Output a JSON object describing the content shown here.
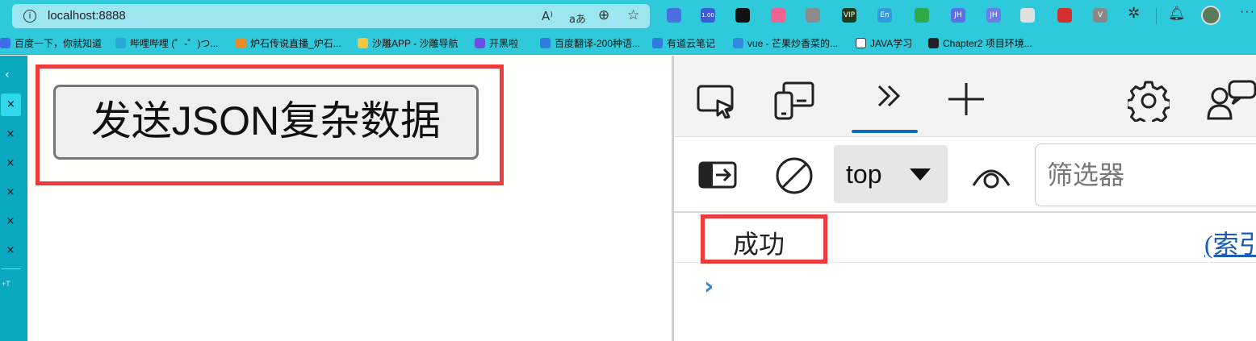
{
  "browser": {
    "url": "localhost:8888",
    "read_aloud_icon": "A⁾",
    "translate_icon": "aあ",
    "zoom_icon": "⊕",
    "favorite_icon": "☆"
  },
  "extensions": [
    {
      "name": "bird-extension-icon",
      "color": "#4a6ee0",
      "label": ""
    },
    {
      "name": "video-extension-icon",
      "color": "#3b5bdb",
      "label": "1.00"
    },
    {
      "name": "panda-extension-icon",
      "color": "#111111",
      "label": ""
    },
    {
      "name": "pink-extension-icon",
      "color": "#f06292",
      "label": ""
    },
    {
      "name": "book-extension-icon",
      "color": "#8c8c8c",
      "label": ""
    },
    {
      "name": "vip-extension-icon",
      "color": "#1d3b1d",
      "label": "VIP"
    },
    {
      "name": "translate-extension-icon",
      "color": "#2f9be0",
      "label": "En"
    },
    {
      "name": "shield-extension-icon",
      "color": "#2eaa4a",
      "label": ""
    },
    {
      "name": "jh-extension-icon",
      "color": "#5b6ee8",
      "label": "JH"
    },
    {
      "name": "jh2-extension-icon",
      "color": "#6a7ce8",
      "label": "JH"
    },
    {
      "name": "chat-extension-icon",
      "color": "#e0e0e0",
      "label": ""
    },
    {
      "name": "red-extension-icon",
      "color": "#d32f2f",
      "label": ""
    },
    {
      "name": "vue-extension-icon",
      "color": "#888888",
      "label": "V"
    }
  ],
  "bookmarks": [
    {
      "label": "百度一下，你就知道",
      "color": "#3b6ee8"
    },
    {
      "label": "哔哩哔哩 (゜-゜)つ...",
      "color": "#2aa6d8"
    },
    {
      "label": "炉石传说直播_炉石...",
      "color": "#e88a2a"
    },
    {
      "label": "沙雕APP - 沙雕导航",
      "color": "#f5c542"
    },
    {
      "label": "开黑啦",
      "color": "#6a4ee8"
    },
    {
      "label": "百度翻译-200种语...",
      "color": "#2f7be0"
    },
    {
      "label": "有道云笔记",
      "color": "#2f7be0"
    },
    {
      "label": "vue - 芒果炒香菜的...",
      "color": "#2f8be0"
    },
    {
      "label": "JAVA学习",
      "color": "#ffffff"
    },
    {
      "label": "Chapter2 项目环境...",
      "color": "#222222"
    }
  ],
  "tabstrip": {
    "collapse_icon": "‹",
    "close_glyph": "×",
    "new_tab_label": "+T"
  },
  "page": {
    "button_label": "发送JSON复杂数据"
  },
  "devtools": {
    "context": "top",
    "filter_placeholder": "筛选器",
    "log_message": "成功",
    "log_source": "(索引",
    "prompt": "›"
  },
  "colors": {
    "accent": "#0f6cbd",
    "highlight": "#ef3b3b",
    "chrome": "#2fc9dc"
  }
}
